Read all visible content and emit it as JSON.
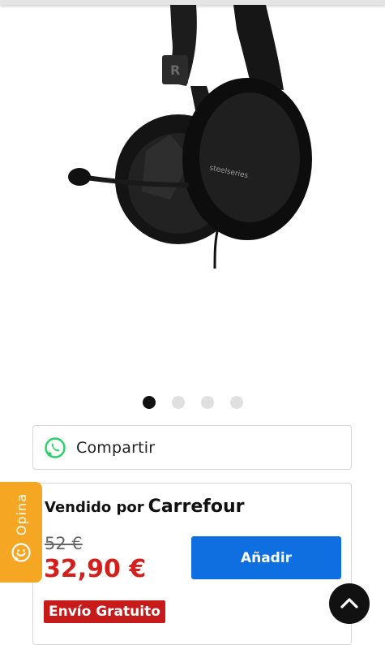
{
  "carousel": {
    "slides": 4,
    "active_index": 0
  },
  "product_image": {
    "brand_logo": "steelseries",
    "channel_letter": "R",
    "icon": "headset-image"
  },
  "share": {
    "label": "Compartir",
    "icon": "whatsapp-icon"
  },
  "seller": {
    "prefix": "Vendido por",
    "name": "Carrefour"
  },
  "pricing": {
    "old_price": "52 €",
    "current_price": "32,90 €"
  },
  "actions": {
    "add_label": "Añadir"
  },
  "shipping": {
    "badge": "Envío Gratuito"
  },
  "feedback": {
    "label": "Opina",
    "icon": "chat-icon"
  },
  "scroll_top": {
    "icon": "chevron-up-icon"
  },
  "colors": {
    "price_red": "#d4201c",
    "button_blue": "#0f6fe0",
    "badge_red": "#c71a1a",
    "opina_orange": "#f5a623",
    "whatsapp_green": "#25d366"
  }
}
